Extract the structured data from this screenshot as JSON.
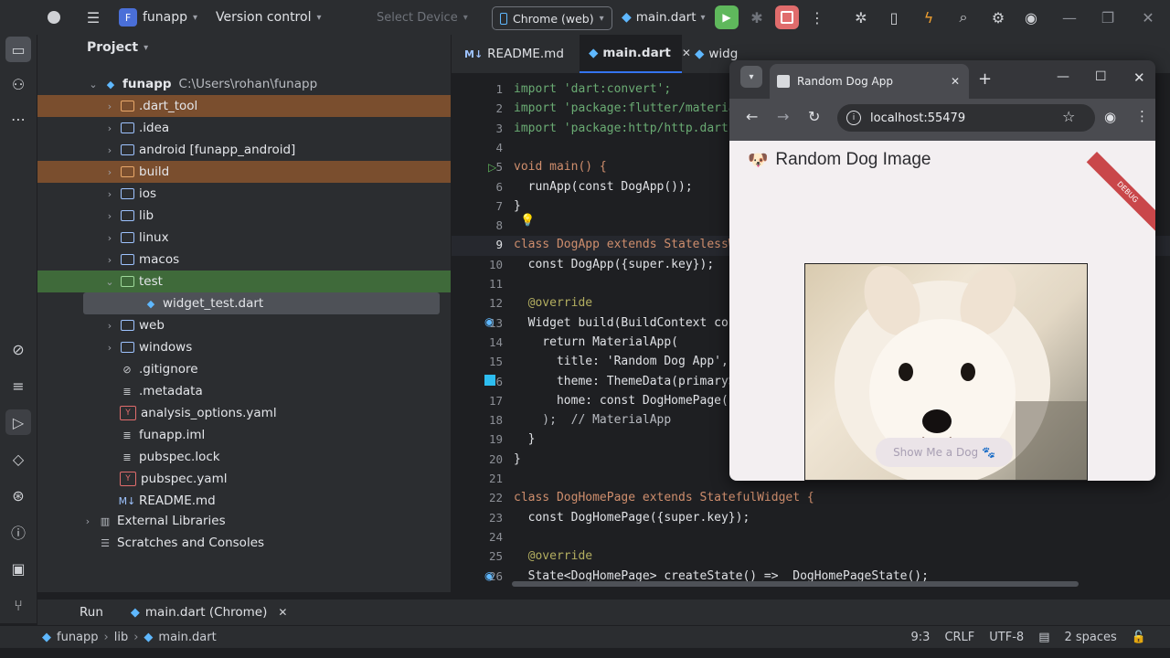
{
  "titlebar": {
    "project_badge": "F",
    "project_name": "funapp",
    "vcs_label": "Version control",
    "device_label": "Select Device",
    "run_target": "Chrome (web)",
    "run_config": "main.dart"
  },
  "project_panel": {
    "title": "Project",
    "root_name": "funapp",
    "root_path": "C:\\Users\\rohan\\funapp",
    "items": [
      {
        "label": ".dart_tool",
        "kind": "folder",
        "highlight": "#7a4e2e"
      },
      {
        "label": ".idea",
        "kind": "folder",
        "highlight": ""
      },
      {
        "label": "android [funapp_android]",
        "kind": "folder",
        "highlight": ""
      },
      {
        "label": "build",
        "kind": "folder",
        "highlight": "#7a4e2e"
      },
      {
        "label": "ios",
        "kind": "folder",
        "highlight": ""
      },
      {
        "label": "lib",
        "kind": "folder",
        "highlight": ""
      },
      {
        "label": "linux",
        "kind": "folder",
        "highlight": ""
      },
      {
        "label": "macos",
        "kind": "folder",
        "highlight": ""
      },
      {
        "label": "test",
        "kind": "folder",
        "highlight": "#3f6a3a"
      },
      {
        "label": "widget_test.dart",
        "kind": "dart",
        "highlight": "#4e5157"
      },
      {
        "label": "web",
        "kind": "folder",
        "highlight": ""
      },
      {
        "label": "windows",
        "kind": "folder",
        "highlight": ""
      },
      {
        "label": ".gitignore",
        "kind": "ignore",
        "highlight": ""
      },
      {
        "label": ".metadata",
        "kind": "meta",
        "highlight": ""
      },
      {
        "label": "analysis_options.yaml",
        "kind": "yaml",
        "highlight": ""
      },
      {
        "label": "funapp.iml",
        "kind": "meta",
        "highlight": ""
      },
      {
        "label": "pubspec.lock",
        "kind": "meta",
        "highlight": ""
      },
      {
        "label": "pubspec.yaml",
        "kind": "yaml",
        "highlight": ""
      },
      {
        "label": "README.md",
        "kind": "md",
        "highlight": ""
      }
    ],
    "external_libraries": "External Libraries",
    "scratches": "Scratches and Consoles"
  },
  "editor": {
    "tabs": [
      {
        "label": "README.md",
        "icon": "M↓"
      },
      {
        "label": "main.dart",
        "icon": "dart"
      },
      {
        "label": "widg",
        "icon": "dart"
      }
    ],
    "lines": [
      "1",
      "2",
      "3",
      "4",
      "5",
      "6",
      "7",
      "8",
      "9",
      "10",
      "11",
      "12",
      "13",
      "14",
      "15",
      "16",
      "17",
      "18",
      "19",
      "20",
      "21",
      "22",
      "23",
      "24",
      "25",
      "26"
    ],
    "code": [
      "import 'dart:convert';",
      "import 'package:flutter/materia",
      "import 'package:http/http.dart'",
      "",
      "void main() {",
      "  runApp(const DogApp());",
      "}",
      "",
      "class DogApp extends StatelessW",
      "  const DogApp({super.key});",
      "",
      "  @override",
      "  Widget build(BuildContext con",
      "    return MaterialApp(",
      "      title: 'Random Dog App',",
      "      theme: ThemeData(primaryS",
      "      home: const DogHomePage()",
      "    );  // MaterialApp",
      "  }",
      "}",
      "",
      "class DogHomePage extends StatefulWidget {",
      "  const DogHomePage({super.key});",
      "",
      "  @override",
      "  State<DogHomePage> createState() => _DogHomePageState();"
    ]
  },
  "browser": {
    "tab_title": "Random Dog App",
    "url": "localhost:55479",
    "debug_banner": "DEBUG",
    "app_title": "Random Dog Image",
    "title_emoji": "🐶",
    "button_label": "Show Me a Dog 🐾"
  },
  "runbar": {
    "run_label": "Run",
    "run_tab": "main.dart (Chrome)"
  },
  "statusbar": {
    "breadcrumb": [
      "funapp",
      "lib",
      "main.dart"
    ],
    "position": "9:3",
    "line_ending": "CRLF",
    "encoding": "UTF-8",
    "indent": "2 spaces"
  },
  "colors": {
    "accent_run": "#5fb85c",
    "accent_stop": "#e06c6c",
    "debug_ribbon": "#c9474a"
  }
}
